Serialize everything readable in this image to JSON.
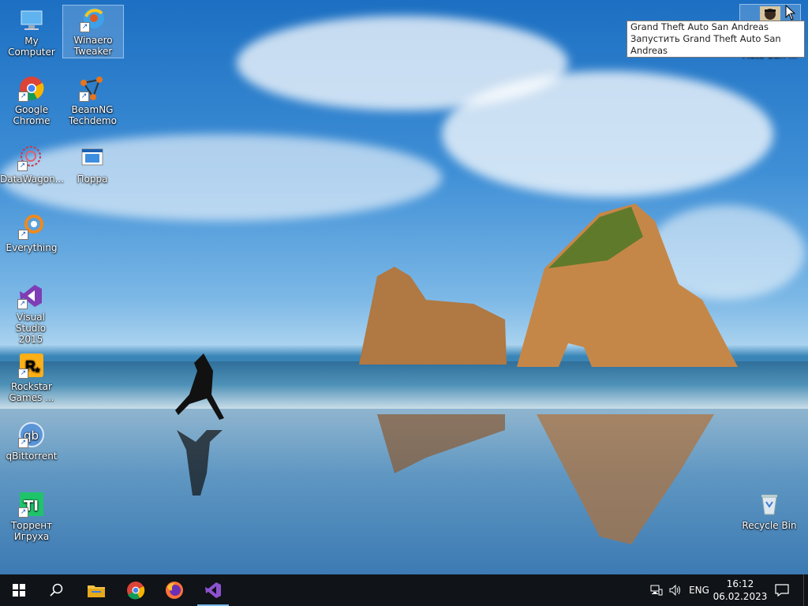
{
  "desktop_icons": [
    {
      "label": "My Computer",
      "icon": "computer-icon"
    },
    {
      "label": "Winaero Tweaker",
      "icon": "winaero-icon"
    },
    {
      "label": "Google Chrome",
      "icon": "chrome-icon"
    },
    {
      "label": "BeamNG Techdemo",
      "icon": "beamng-icon"
    },
    {
      "label": "DataWagon...",
      "icon": "datawagon-icon"
    },
    {
      "label": "Поррa",
      "icon": "window-icon"
    },
    {
      "label": "Everything",
      "icon": "everything-icon"
    },
    {
      "label": "Visual Studio 2015",
      "icon": "visual-studio-icon"
    },
    {
      "label": "Rockstar Games ...",
      "icon": "rockstar-icon"
    },
    {
      "label": "qBittorrent",
      "icon": "qbittorrent-icon"
    },
    {
      "label": "Торрент Игруха",
      "icon": "torrent-igruha-icon"
    },
    {
      "label": "Recycle Bin",
      "icon": "recycle-bin-icon"
    },
    {
      "label": "Auto San ...",
      "icon": "gta-icon"
    }
  ],
  "tooltip": {
    "line1": "Grand Theft Auto San Andreas",
    "line2": "Запустить Grand Theft Auto San Andreas"
  },
  "taskbar": {
    "language": "ENG",
    "time": "16:12",
    "date": "06.02.2023"
  },
  "colors": {
    "taskbar_bg": "#101317",
    "accent": "#76b9ed"
  }
}
